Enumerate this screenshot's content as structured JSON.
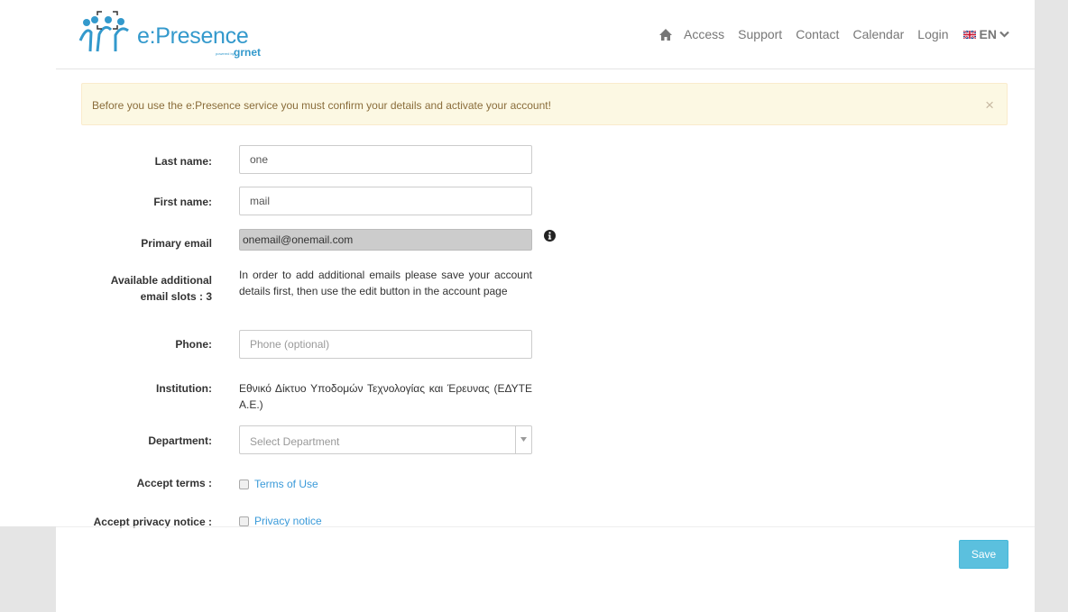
{
  "header": {
    "logo_text": "e:Presence",
    "logo_powered": "powered by",
    "logo_grnet": "grnet",
    "nav": [
      "Access",
      "Support",
      "Contact",
      "Calendar",
      "Login"
    ],
    "language": "EN",
    "icons": [
      "home-icon",
      "uk-flag-icon",
      "chevron-down-icon"
    ]
  },
  "alert": {
    "text": "Before you use the e:Presence service you must confirm your details and activate your account!",
    "close": "×"
  },
  "form": {
    "last_name_label": "Last name:",
    "last_name_value": "one",
    "first_name_label": "First name:",
    "first_name_value": "mail",
    "primary_email_label": "Primary email",
    "primary_email_value": "onemail@onemail.com",
    "additional_email_label_line1": "Available additional",
    "additional_email_label_line2": "email slots : 3",
    "additional_email_text": "In order to add additional emails please save your account details first, then use the edit button in the account page",
    "phone_label": "Phone:",
    "phone_placeholder": "Phone (optional)",
    "institution_label": "Institution:",
    "institution_value": "Εθνικό Δίκτυο Υποδομών Τεχνολογίας και Έρευνας (ΕΔΥΤΕ Α.Ε.)",
    "department_label": "Department:",
    "department_value": "Select Department",
    "accept_terms_label": "Accept terms :",
    "terms_link": "Terms of Use",
    "accept_privacy_label": "Accept privacy notice :",
    "privacy_link": "Privacy notice",
    "save_label": "Save"
  },
  "colors": {
    "brand": "#3399cc",
    "alert_bg": "#fcf8e3",
    "alert_text": "#8a6d3b",
    "link": "#3a9ad9",
    "save_button": "#5bc0de"
  }
}
